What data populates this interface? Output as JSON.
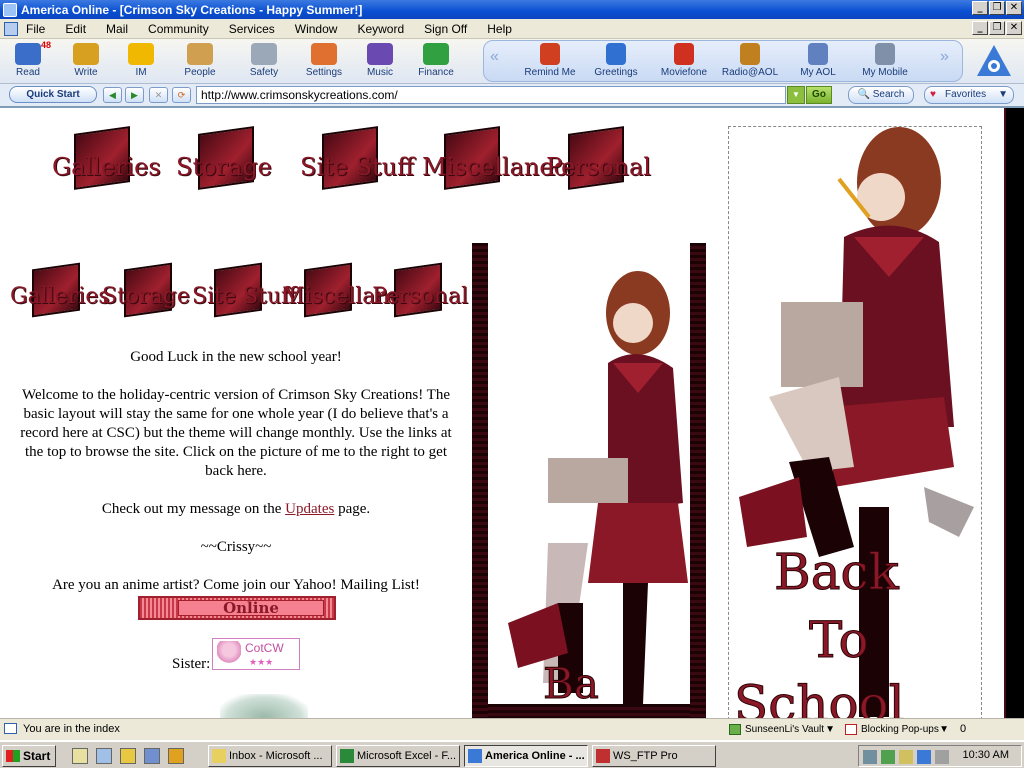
{
  "window": {
    "title": "America  Online - [Crimson Sky Creations - Happy Summer!]"
  },
  "menu": [
    "File",
    "Edit",
    "Mail",
    "Community",
    "Services",
    "Window",
    "Keyword",
    "Sign Off",
    "Help"
  ],
  "toolbar": {
    "read_badge": "48",
    "buttons": [
      {
        "label": "Read",
        "icon": "mailbox-icon",
        "color": "#3a6ec8"
      },
      {
        "label": "Write",
        "icon": "pencil-paper-icon",
        "color": "#d8a020"
      },
      {
        "label": "IM",
        "icon": "running-man-icon",
        "color": "#f0b800"
      },
      {
        "label": "People",
        "icon": "people-icon",
        "color": "#d0a050"
      },
      {
        "label": "Safety",
        "icon": "shield-icon",
        "color": "#9aa8b8"
      },
      {
        "label": "Settings",
        "icon": "settings-icon",
        "color": "#e07030"
      },
      {
        "label": "Music",
        "icon": "headphones-icon",
        "color": "#6a4ab0"
      },
      {
        "label": "Finance",
        "icon": "money-icon",
        "color": "#30a040"
      }
    ],
    "panel_buttons": [
      {
        "label": "Remind Me",
        "icon": "reminder-icon",
        "color": "#d04020"
      },
      {
        "label": "Greetings",
        "icon": "card-icon",
        "color": "#3070d0"
      },
      {
        "label": "Moviefone",
        "icon": "popcorn-icon",
        "color": "#d03020"
      },
      {
        "label": "Radio@AOL",
        "icon": "radio-icon",
        "color": "#c08020"
      },
      {
        "label": "My AOL",
        "icon": "document-icon",
        "color": "#6080c0"
      },
      {
        "label": "My Mobile",
        "icon": "phone-icon",
        "color": "#8090a8"
      }
    ]
  },
  "address": {
    "quick_start": "Quick Start",
    "url": "http://www.crimsonskycreations.com/",
    "go": "Go",
    "search": "Search",
    "favorites": "Favorites"
  },
  "page": {
    "nav_large": [
      "Galleries",
      "Storage",
      "Site Stuff",
      "Miscellaneous",
      "Personal"
    ],
    "nav_small": [
      "Galleries",
      "Storage",
      "Site Stuff",
      "Miscellaneous",
      "Personal"
    ],
    "greeting": "Good Luck in the new school year!",
    "welcome": "Welcome to the holiday-centric version of Crimson Sky Creations! The basic layout will stay the same for one whole year (I do believe that's a record here at CSC) but the theme will change monthly. Use the links at the top to browse the site. Click on the picture of me to the right to get back here.",
    "message_pre": "Check out my message on the ",
    "message_link": "Updates",
    "message_post": " page.",
    "signature": "~~Crissy~~",
    "anime_prompt": "Are you an anime artist? Come join our Yahoo! Mailing List!",
    "online_banner": "Online",
    "sister_label": "Sister:",
    "sister_badge": "CotCW",
    "back_to_school": "Back To School"
  },
  "status": {
    "message": "You are in the index",
    "vault": "SunseenLi's Vault",
    "popups": "Blocking Pop-ups",
    "count": "0"
  },
  "taskbar": {
    "start": "Start",
    "items": [
      "Inbox - Microsoft ...",
      "Microsoft Excel - F...",
      "America  Online - ...",
      "WS_FTP Pro"
    ],
    "clock": "10:30 AM"
  },
  "colors": {
    "crimson": "#8a1826",
    "dark_crimson": "#3a0810",
    "aol_blue": "#0a4fd3"
  }
}
